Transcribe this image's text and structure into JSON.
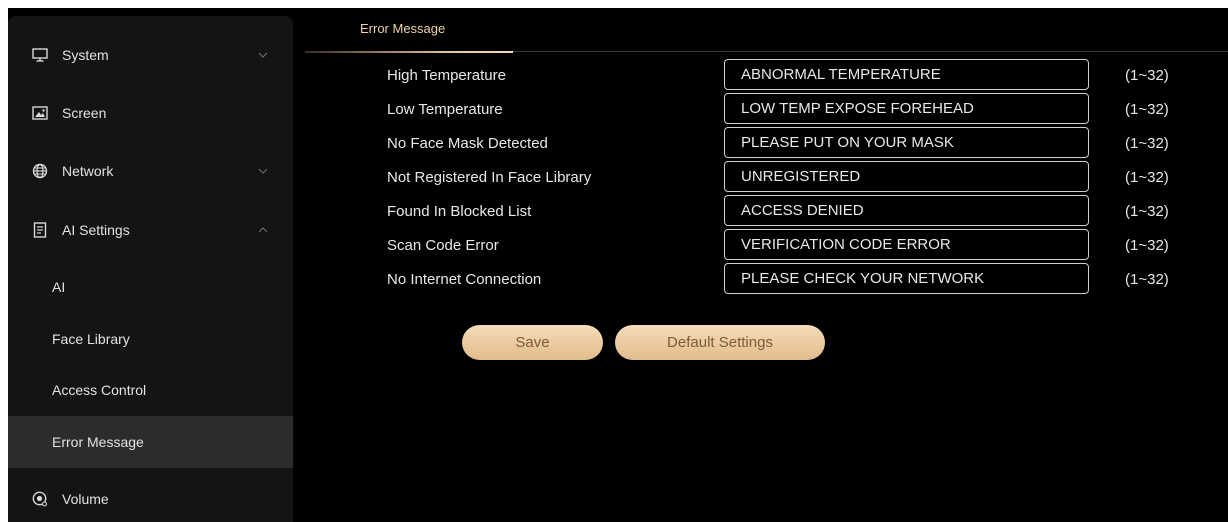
{
  "sidebar": {
    "items": [
      {
        "label": "System",
        "icon": "monitor-icon",
        "chevron": "down"
      },
      {
        "label": "Screen",
        "icon": "image-icon"
      },
      {
        "label": "Network",
        "icon": "globe-icon",
        "chevron": "down"
      },
      {
        "label": "AI Settings",
        "icon": "document-icon",
        "chevron": "up"
      },
      {
        "label": "Volume",
        "icon": "speaker-icon"
      }
    ],
    "subitems": [
      {
        "label": "AI"
      },
      {
        "label": "Face Library"
      },
      {
        "label": "Access Control"
      },
      {
        "label": "Error Message",
        "active": true
      }
    ]
  },
  "tabs": [
    {
      "label": "Error Message",
      "active": true
    }
  ],
  "form": {
    "rows": [
      {
        "label": "High Temperature",
        "value": "ABNORMAL TEMPERATURE",
        "range": "(1~32)"
      },
      {
        "label": "Low Temperature",
        "value": "LOW TEMP EXPOSE FOREHEAD",
        "range": "(1~32)"
      },
      {
        "label": "No Face Mask Detected",
        "value": "PLEASE PUT ON YOUR MASK",
        "range": "(1~32)"
      },
      {
        "label": "Not Registered In Face Library",
        "value": "UNREGISTERED",
        "range": "(1~32)"
      },
      {
        "label": "Found In Blocked List",
        "value": "ACCESS DENIED",
        "range": "(1~32)"
      },
      {
        "label": "Scan Code Error",
        "value": "VERIFICATION CODE ERROR",
        "range": "(1~32)"
      },
      {
        "label": "No Internet Connection",
        "value": "PLEASE CHECK YOUR NETWORK",
        "range": "(1~32)"
      }
    ]
  },
  "buttons": {
    "save": "Save",
    "default": "Default Settings"
  },
  "colors": {
    "accent": "#e8c79a",
    "background": "#000000",
    "sidebar": "#141414",
    "active_item": "#2c2c2c"
  }
}
